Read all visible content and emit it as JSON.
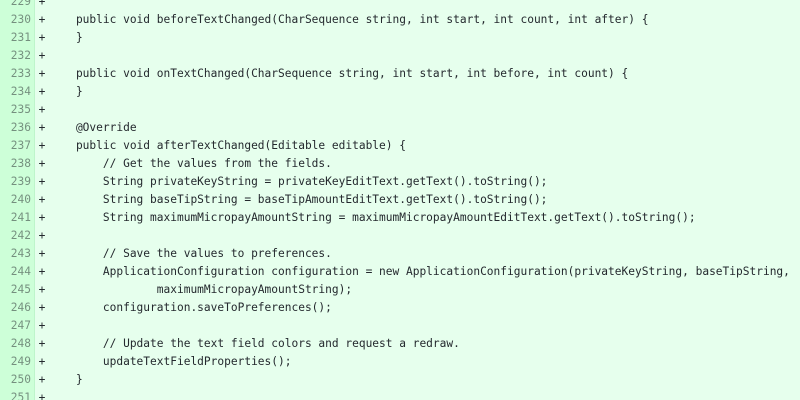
{
  "diff": {
    "lines": [
      {
        "num": "229",
        "sign": "+",
        "code": ""
      },
      {
        "num": "230",
        "sign": "+",
        "code": "    public void beforeTextChanged(CharSequence string, int start, int count, int after) {"
      },
      {
        "num": "231",
        "sign": "+",
        "code": "    }"
      },
      {
        "num": "232",
        "sign": "+",
        "code": ""
      },
      {
        "num": "233",
        "sign": "+",
        "code": "    public void onTextChanged(CharSequence string, int start, int before, int count) {"
      },
      {
        "num": "234",
        "sign": "+",
        "code": "    }"
      },
      {
        "num": "235",
        "sign": "+",
        "code": ""
      },
      {
        "num": "236",
        "sign": "+",
        "code": "    @Override"
      },
      {
        "num": "237",
        "sign": "+",
        "code": "    public void afterTextChanged(Editable editable) {"
      },
      {
        "num": "238",
        "sign": "+",
        "code": "        // Get the values from the fields."
      },
      {
        "num": "239",
        "sign": "+",
        "code": "        String privateKeyString = privateKeyEditText.getText().toString();"
      },
      {
        "num": "240",
        "sign": "+",
        "code": "        String baseTipString = baseTipAmountEditText.getText().toString();"
      },
      {
        "num": "241",
        "sign": "+",
        "code": "        String maximumMicropayAmountString = maximumMicropayAmountEditText.getText().toString();"
      },
      {
        "num": "242",
        "sign": "+",
        "code": ""
      },
      {
        "num": "243",
        "sign": "+",
        "code": "        // Save the values to preferences."
      },
      {
        "num": "244",
        "sign": "+",
        "code": "        ApplicationConfiguration configuration = new ApplicationConfiguration(privateKeyString, baseTipString,"
      },
      {
        "num": "245",
        "sign": "+",
        "code": "                maximumMicropayAmountString);"
      },
      {
        "num": "246",
        "sign": "+",
        "code": "        configuration.saveToPreferences();"
      },
      {
        "num": "247",
        "sign": "+",
        "code": ""
      },
      {
        "num": "248",
        "sign": "+",
        "code": "        // Update the text field colors and request a redraw."
      },
      {
        "num": "249",
        "sign": "+",
        "code": "        updateTextFieldProperties();"
      },
      {
        "num": "250",
        "sign": "+",
        "code": "    }"
      },
      {
        "num": "251",
        "sign": "+",
        "code": ""
      }
    ]
  },
  "colors": {
    "added_line_bg": "#e6ffed",
    "added_gutter_bg": "#cdffd8",
    "gutter_border": "#bef5cb",
    "text": "#24292e"
  }
}
